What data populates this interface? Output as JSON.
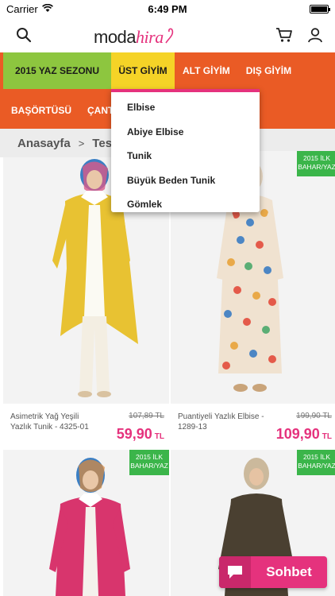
{
  "status_bar": {
    "carrier": "Carrier",
    "time": "6:49 PM",
    "battery_level": 1.0
  },
  "header": {
    "logo_part1": "moda",
    "logo_part2": "hira"
  },
  "nav": {
    "row1": [
      "2015 YAZ SEZONU",
      "ÜST GİYİM",
      "ALT GİYİM",
      "DIŞ GİYİM"
    ],
    "row2": [
      "BAŞÖRTÜSÜ",
      "ÇANT"
    ],
    "active": "ÜST GİYİM"
  },
  "dropdown": {
    "items": [
      "Elbise",
      "Abiye Elbise",
      "Tunik",
      "Büyük Beden Tunik",
      "Gömlek"
    ]
  },
  "breadcrumb": {
    "home": "Anasayfa",
    "separator": ">",
    "current": "Tes"
  },
  "products": [
    {
      "name": "Asimetrik Yağ Yeşili Yazlık Tunik - 4325-01",
      "old_price": "107,89 TL",
      "price": "59,90",
      "currency": "TL",
      "badge": "",
      "colors": {
        "top": "#e8c232",
        "bottom": "#f4eee0"
      }
    },
    {
      "name": "Puantiyeli Yazlık Elbise - 1289-13",
      "old_price": "199,90 TL",
      "price": "109,90",
      "currency": "TL",
      "badge": "2015 İLK BAHAR/YAZ",
      "colors": {
        "top": "#f1e6d6",
        "bottom": "#f1e6d6"
      }
    },
    {
      "name": "",
      "old_price": "",
      "price": "",
      "currency": "",
      "badge": "2015 İLK BAHAR/YAZ",
      "colors": {
        "top": "#d8356d",
        "bottom": "#f2efe9"
      }
    },
    {
      "name": "",
      "old_price": "",
      "price": "",
      "currency": "",
      "badge": "2015 İLK BAHAR/YAZ",
      "colors": {
        "top": "#4a4031",
        "bottom": "#4a4031"
      }
    }
  ],
  "chat": {
    "label": "Sohbet"
  },
  "colors": {
    "accent": "#e5327d",
    "nav_orange": "#ea5b25",
    "nav_green": "#8dc63f",
    "nav_yellow": "#f5d327",
    "badge_green": "#3bb54a"
  }
}
